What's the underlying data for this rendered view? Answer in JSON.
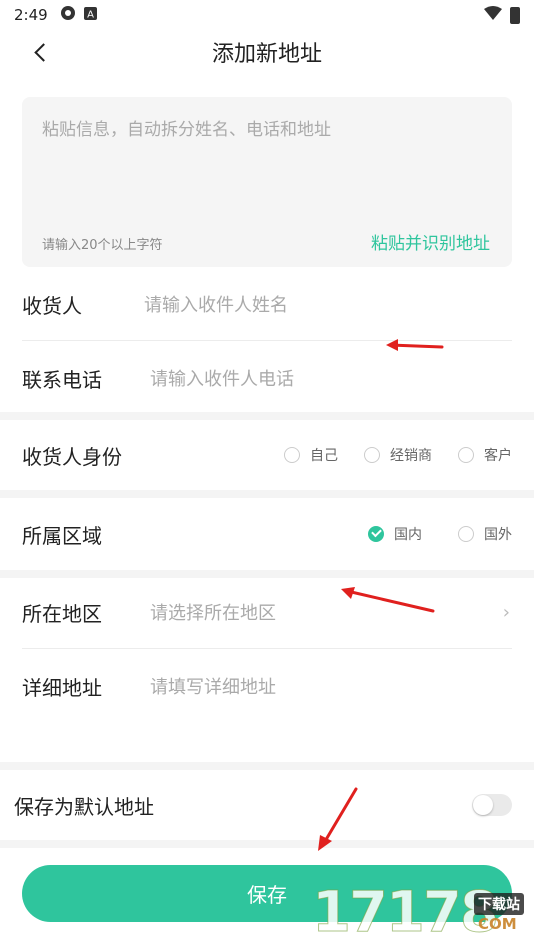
{
  "status_bar": {
    "time": "2:49",
    "icons": [
      "settings-icon",
      "a-badge-icon"
    ],
    "right_icons": [
      "wifi-icon",
      "battery-icon"
    ]
  },
  "header": {
    "title": "添加新地址",
    "back_icon": "chevron-left-icon"
  },
  "paste_box": {
    "placeholder": "粘贴信息，自动拆分姓名、电话和地址",
    "hint": "请输入20个以上字符",
    "paste_label": "粘贴并识别地址"
  },
  "form": {
    "recipient": {
      "label": "收货人",
      "placeholder": "请输入收件人姓名"
    },
    "phone": {
      "label": "联系电话",
      "placeholder": "请输入收件人电话"
    },
    "identity": {
      "label": "收货人身份",
      "options": [
        {
          "label": "自己",
          "checked": false
        },
        {
          "label": "经销商",
          "checked": false
        },
        {
          "label": "客户",
          "checked": false
        }
      ]
    },
    "area": {
      "label": "所属区域",
      "options": [
        {
          "label": "国内",
          "checked": true
        },
        {
          "label": "国外",
          "checked": false
        }
      ]
    },
    "region": {
      "label": "所在地区",
      "placeholder": "请选择所在地区",
      "chevron": "›"
    },
    "detail": {
      "label": "详细地址",
      "placeholder": "请填写详细地址"
    },
    "default": {
      "label": "保存为默认地址",
      "enabled": false
    }
  },
  "save_button": {
    "label": "保存"
  },
  "watermark": {
    "text": "17178",
    "tag": "下载站",
    "domain": "COM"
  },
  "colors": {
    "accent": "#2fc59d",
    "annotation_arrow": "#e0201e"
  }
}
